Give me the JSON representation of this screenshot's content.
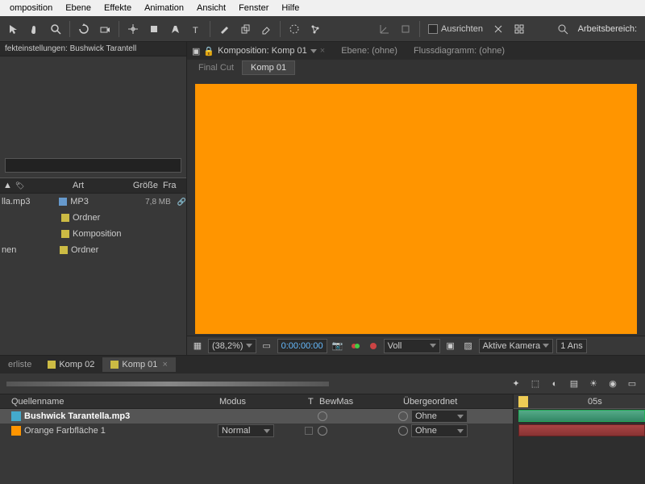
{
  "menu": [
    "omposition",
    "Ebene",
    "Effekte",
    "Animation",
    "Ansicht",
    "Fenster",
    "Hilfe"
  ],
  "toolbar": {
    "ausrichten": "Ausrichten",
    "arbeitsbereich": "Arbeitsbereich:"
  },
  "effects_panel": {
    "title": "fekteinstellungen: Bushwick Tarantell"
  },
  "project": {
    "headers": {
      "art": "Art",
      "size": "Größe",
      "fr": "Fra"
    },
    "rows": [
      {
        "name": "lla.mp3",
        "type": "MP3",
        "size": "7,8 MB",
        "icon": "mp3"
      },
      {
        "name": "",
        "type": "Ordner",
        "size": "",
        "icon": "folder"
      },
      {
        "name": "",
        "type": "Komposition",
        "size": "",
        "icon": "folder"
      },
      {
        "name": "nen",
        "type": "Ordner",
        "size": "",
        "icon": "folder"
      }
    ]
  },
  "viewer": {
    "tabs": {
      "comp": "Komposition: Komp 01",
      "ebene": "Ebene: (ohne)",
      "fluss": "Flussdiagramm: (ohne)"
    },
    "subtabs": {
      "final": "Final Cut",
      "active": "Komp 01"
    },
    "controls": {
      "zoom": "(38,2%)",
      "time": "0:00:00:00",
      "res": "Voll",
      "camera": "Aktive Kamera",
      "views": "1 Ans"
    }
  },
  "timeline": {
    "tabs": {
      "erliste": "erliste",
      "komp02": "Komp 02",
      "komp01": "Komp 01"
    },
    "headers": {
      "name": "Quellenname",
      "mode": "Modus",
      "t": "T",
      "bewmas": "BewMas",
      "parent": "Übergeordnet"
    },
    "layers": [
      {
        "name": "Bushwick Tarantella.mp3",
        "mode": "",
        "parent": "Ohne",
        "swatch": "audio"
      },
      {
        "name": "Orange Farbfläche 1",
        "mode": "Normal",
        "parent": "Ohne",
        "swatch": "orange"
      }
    ],
    "ruler": {
      "tick1": "05s"
    }
  }
}
